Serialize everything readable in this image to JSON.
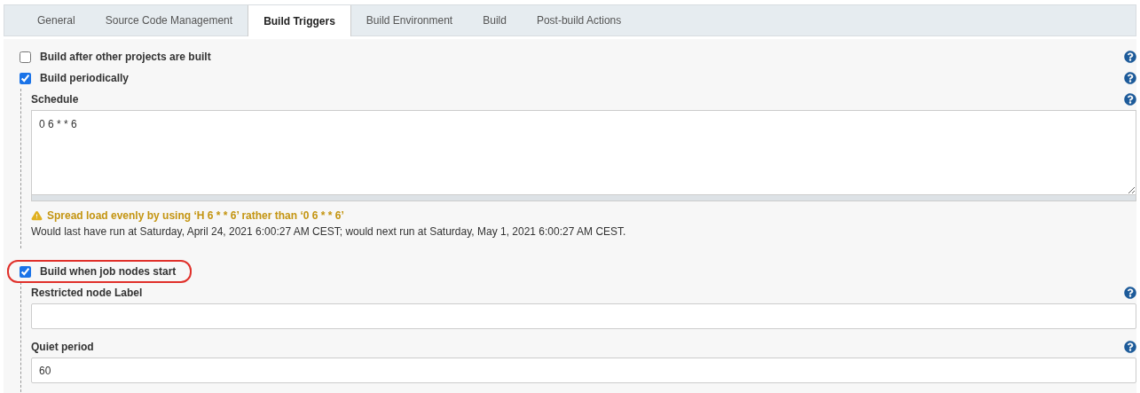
{
  "tabs": [
    {
      "label": "General",
      "selected": false
    },
    {
      "label": "Source Code Management",
      "selected": false
    },
    {
      "label": "Build Triggers",
      "selected": true
    },
    {
      "label": "Build Environment",
      "selected": false
    },
    {
      "label": "Build",
      "selected": false
    },
    {
      "label": "Post-build Actions",
      "selected": false
    }
  ],
  "triggers": [
    {
      "label": "Build after other projects are built",
      "checked": false,
      "highlighted": false,
      "help": true
    },
    {
      "label": "Build periodically",
      "checked": true,
      "highlighted": false,
      "help": true,
      "fields": [
        {
          "kind": "textarea",
          "label": "Schedule",
          "value": "0 6 * * 6",
          "warning": "Spread load evenly by using ‘H 6 * * 6’ rather than ‘0 6 * * 6’",
          "info": "Would last have run at Saturday, April 24, 2021 6:00:27 AM CEST; would next run at Saturday, May 1, 2021 6:00:27 AM CEST."
        }
      ]
    },
    {
      "label": "Build when job nodes start",
      "checked": true,
      "highlighted": true,
      "help": false,
      "fields": [
        {
          "kind": "text",
          "label": "Restricted node Label"
        },
        {
          "kind": "text",
          "label": "Quiet period",
          "value": "60"
        }
      ]
    }
  ]
}
